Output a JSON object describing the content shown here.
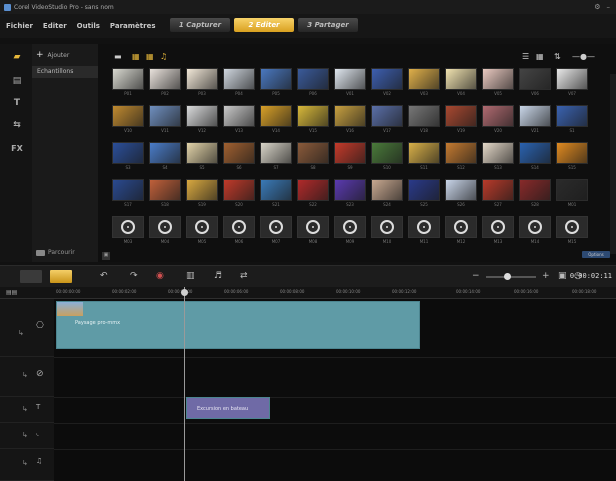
{
  "window": {
    "title": "Corel VideoStudio Pro - sans nom"
  },
  "menu": {
    "items": [
      "Fichier",
      "Editer",
      "Outils",
      "Paramètres"
    ]
  },
  "steps": {
    "tabs": [
      {
        "label": "1 Capturer",
        "active": false
      },
      {
        "label": "2 Editer",
        "active": true
      },
      {
        "label": "3 Partager",
        "active": false
      }
    ]
  },
  "folder": {
    "add_label": "Ajouter",
    "selected_folder": "Echantillons",
    "browse_label": "Parcourir"
  },
  "library": {
    "rows": [
      {
        "labels": [
          "P01",
          "P02",
          "P03",
          "P04",
          "P05",
          "P06",
          "V01",
          "V02",
          "V03",
          "V04",
          "V05",
          "V06",
          "V07"
        ],
        "colors": [
          "#d8d8d0",
          "#e9e2dc",
          "#f2e8d8",
          "#cfd6de",
          "#4a78c0",
          "#3a5a9a",
          "#dfe6ee",
          "#3d5fb0",
          "#e0b04a",
          "#f0e2b0",
          "#e9c9c0",
          "#444444",
          "#e8e8e8"
        ]
      },
      {
        "labels": [
          "V10",
          "V11",
          "V12",
          "V13",
          "V14",
          "V15",
          "V16",
          "V17",
          "V18",
          "V19",
          "V20",
          "V21",
          "S1"
        ],
        "colors": [
          "#c08a30",
          "#6f8fbf",
          "#d9dadb",
          "#c9c9c9",
          "#d8a028",
          "#d7b83a",
          "#c7a040",
          "#5a6fa8",
          "#777777",
          "#a84830",
          "#b06a70",
          "#c9d6e8",
          "#3a62b0"
        ]
      },
      {
        "labels": [
          "S3",
          "S4",
          "S5",
          "S6",
          "S7",
          "S8",
          "S9",
          "S10",
          "S11",
          "S12",
          "S13",
          "S14",
          "S15"
        ],
        "colors": [
          "#2b4f9a",
          "#4a7cc8",
          "#e2d3a8",
          "#a06030",
          "#d8d4c8",
          "#8a5a3a",
          "#c43a2a",
          "#4a7a3a",
          "#d8b048",
          "#c47a30",
          "#e4d8c8",
          "#2a62b0",
          "#e08a20"
        ]
      },
      {
        "labels": [
          "S17",
          "S18",
          "S19",
          "S20",
          "S21",
          "S22",
          "S23",
          "S24",
          "S25",
          "S26",
          "S27",
          "S28",
          "M01"
        ],
        "colors": [
          "#2a4a90",
          "#c0603a",
          "#d8a840",
          "#c03a2a",
          "#3a7ab8",
          "#b02a2a",
          "#5a3ab0",
          "#c8a890",
          "#2a3a8a",
          "#c8d4e8",
          "#b83a2a",
          "#882a2a",
          "#2b2b2b"
        ]
      },
      {
        "labels": [
          "M03",
          "M04",
          "M05",
          "M06",
          "M07",
          "M08",
          "M09",
          "M10",
          "M11",
          "M12",
          "M13",
          "M14",
          "M15"
        ],
        "colors": [
          "disc",
          "disc",
          "disc",
          "disc",
          "disc",
          "disc",
          "disc",
          "disc",
          "disc",
          "disc",
          "disc",
          "disc",
          "disc"
        ]
      }
    ],
    "extra_label": "M02",
    "options_label": "Options"
  },
  "timeline": {
    "timecode": "0:00:02:11",
    "ruler_ticks": [
      "00:00:00:00",
      "00:00:02:00",
      "00:00:04:00",
      "00:00:06:00",
      "00:00:08:00",
      "00:00:10:00",
      "00:00:12:00",
      "00:00:14:00",
      "00:00:16:00",
      "00:00:18:00"
    ],
    "video_clip_label": "Paysage pro-mmx",
    "title_clip_label": "Excursion en bateau",
    "colors": {
      "video_clip": "#5f9ba6",
      "title_clip": "#6f6aa6",
      "accent": "#e7b83b"
    }
  }
}
